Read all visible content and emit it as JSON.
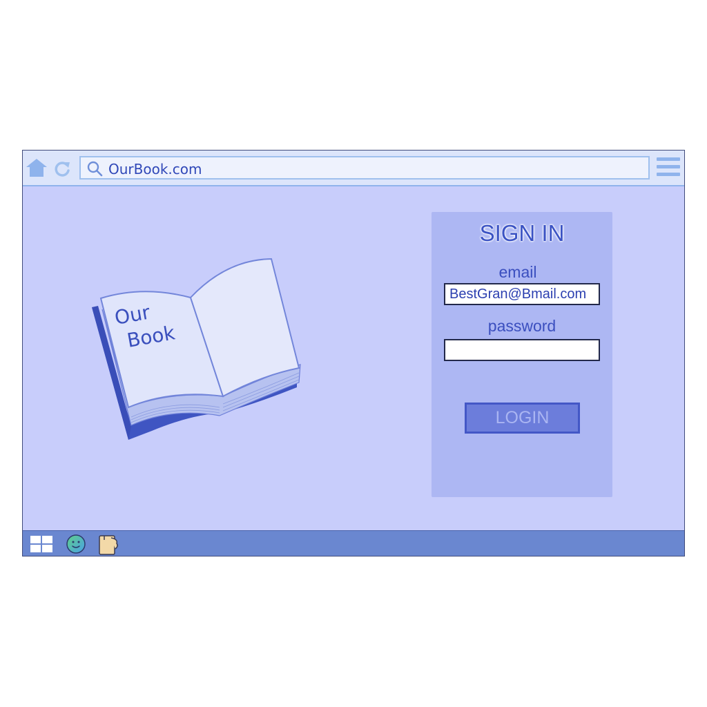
{
  "browser": {
    "url": "OurBook.com",
    "icons": {
      "home": "home-icon",
      "reload": "reload-icon",
      "search": "search-icon",
      "menu": "hamburger-menu-icon"
    }
  },
  "illustration": {
    "book_text_line1": "Our",
    "book_text_line2": "Book"
  },
  "signin": {
    "title": "SIGN IN",
    "email_label": "email",
    "email_value": "BestGran@Bmail.com",
    "password_label": "password",
    "password_value": "",
    "login_label": "LOGIN"
  },
  "taskbar": {
    "icons": [
      "windows-start-icon",
      "smiley-icon",
      "notes-icon"
    ]
  },
  "colors": {
    "page_background": "#c8cdfb",
    "panel_background": "#adb7f3",
    "accent": "#3b53c4",
    "taskbar": "#6a87d0"
  }
}
